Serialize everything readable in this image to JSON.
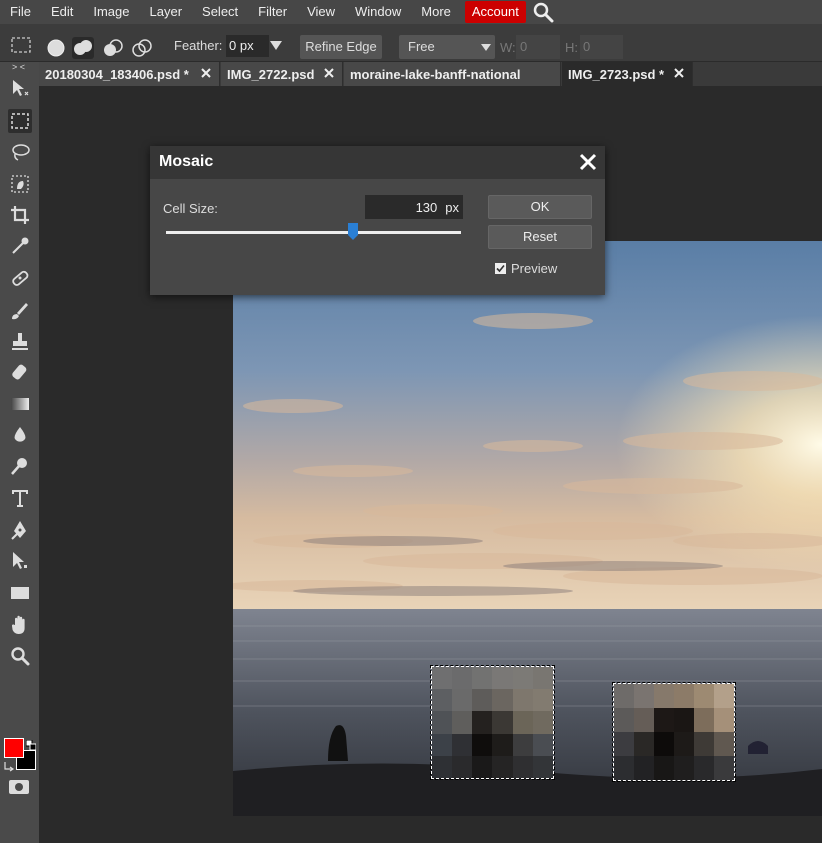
{
  "menubar": {
    "items": [
      "File",
      "Edit",
      "Image",
      "Layer",
      "Select",
      "Filter",
      "View",
      "Window",
      "More"
    ],
    "account": "Account",
    "search_icon": "search-icon"
  },
  "options": {
    "feather_label": "Feather:",
    "feather_value": "0 px",
    "refine_edge": "Refine Edge",
    "style_value": "Free",
    "w_label": "W:",
    "w_value": "0",
    "h_label": "H:",
    "h_value": "0"
  },
  "tabs": [
    {
      "title": "20180304_183406.psd *"
    },
    {
      "title": "IMG_2722.psd"
    },
    {
      "title": "moraine-lake-banff-national"
    },
    {
      "title": "IMG_2723.psd *"
    }
  ],
  "toolbar": {
    "collapse": "> <",
    "tools": [
      "move-tool",
      "marquee-tool",
      "lasso-tool",
      "quick-select-tool",
      "crop-tool",
      "eyedropper-tool",
      "healing-tool",
      "brush-tool",
      "stamp-tool",
      "eraser-tool",
      "gradient-tool",
      "blur-tool",
      "dodge-tool",
      "type-tool",
      "pen-tool",
      "path-select-tool",
      "shape-tool",
      "hand-tool",
      "zoom-tool"
    ],
    "foreground_color": "#ff0000",
    "background_color": "#000000"
  },
  "dialog": {
    "title": "Mosaic",
    "cell_size_label": "Cell Size:",
    "cell_size_value": "130",
    "cell_size_unit": "px",
    "slider_fraction": 0.64,
    "ok": "OK",
    "reset": "Reset",
    "preview_label": "Preview",
    "preview_checked": true
  },
  "colors": {
    "accent_account": "#cc0000",
    "menubar_bg": "#474747",
    "toolbar_bg": "#4a4a4a",
    "canvas_bg": "#2a2a2a"
  }
}
